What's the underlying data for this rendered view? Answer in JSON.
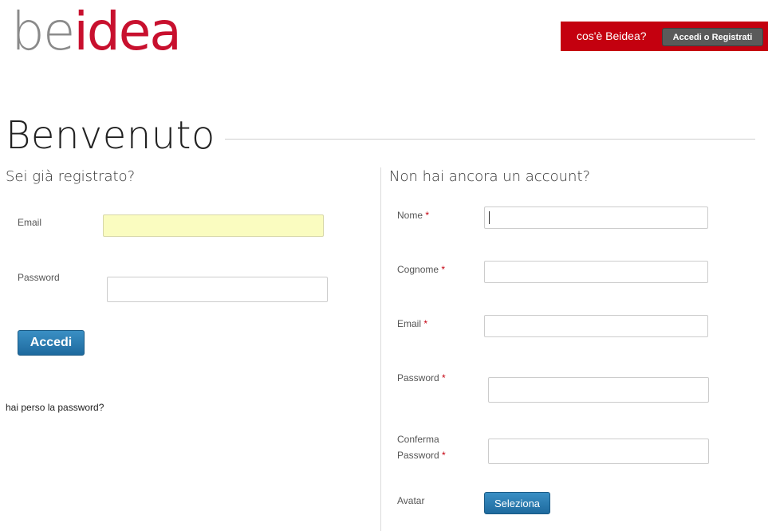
{
  "logo": {
    "part1": "be",
    "part2": "idea"
  },
  "topbar": {
    "about_link": "cos'è Beidea?",
    "login_register_button": "Accedi o Registrati"
  },
  "page": {
    "title": "Benvenuto"
  },
  "login": {
    "title": "Sei già registrato?",
    "email_label": "Email",
    "email_value": "",
    "password_label": "Password",
    "password_value": "",
    "submit_label": "Accedi",
    "forgot_link": "hai perso la password?"
  },
  "register": {
    "title": "Non hai ancora un account?",
    "required_marker": "*",
    "nome_label": "Nome",
    "cognome_label": "Cognome",
    "email_label": "Email",
    "password_label": "Password",
    "confirm_label_line1": "Conferma",
    "confirm_label_line2": "Password",
    "avatar_label": "Avatar",
    "avatar_button": "Seleziona"
  },
  "colors": {
    "brand_red": "#c4000f",
    "button_blue": "#1e6a9e",
    "autofill_yellow": "#fafcc0"
  }
}
